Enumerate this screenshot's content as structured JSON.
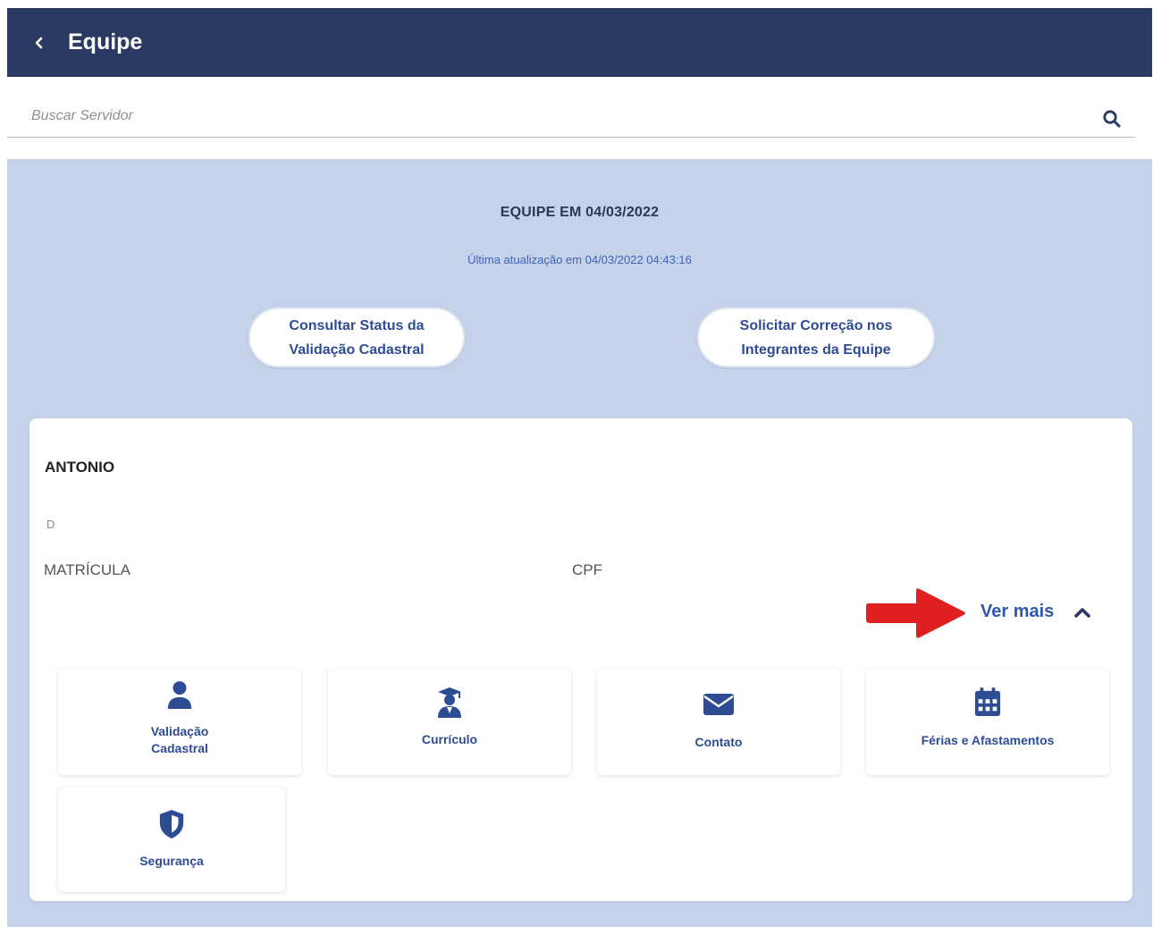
{
  "header": {
    "back_icon": "chevron-left-icon",
    "title": "Equipe"
  },
  "search": {
    "placeholder": "Buscar Servidor",
    "value": "",
    "icon": "search-icon"
  },
  "team": {
    "title": "EQUIPE EM 04/03/2022",
    "last_update": "Última atualização em 04/03/2022 04:43:16"
  },
  "actions": [
    {
      "label": "Consultar Status da Validação Cadastral"
    },
    {
      "label": "Solicitar Correção nos Integrantes da Equipe"
    }
  ],
  "employee": {
    "name": "ANTONIO",
    "line2": "D",
    "matricula_label": "MATRÍCULA",
    "cpf_label": "CPF",
    "ver_mais_label": "Ver mais",
    "ver_mais_icon": "chevron-up-icon"
  },
  "tiles": [
    {
      "label_line1": "Validação",
      "label_line2": "Cadastral",
      "icon": "user-icon"
    },
    {
      "label": "Currículo",
      "icon": "graduate-icon"
    },
    {
      "label": "Contato",
      "icon": "envelope-icon"
    },
    {
      "label": "Férias e Afastamentos",
      "icon": "calendar-icon"
    },
    {
      "label": "Segurança",
      "icon": "shield-icon"
    }
  ],
  "colors": {
    "header_bg": "#2b3a62",
    "page_bg": "#c5d3ea",
    "accent": "#2e4c94",
    "arrow": "#e02020"
  }
}
